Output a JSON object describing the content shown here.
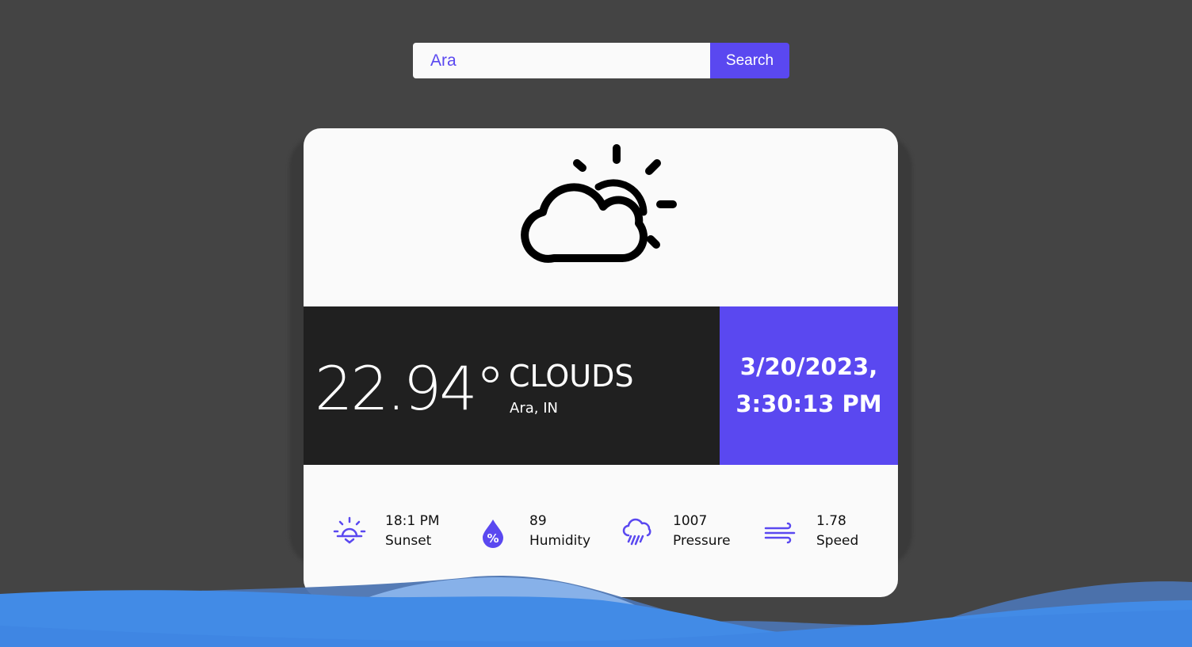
{
  "search": {
    "value": "Ara",
    "button_label": "Search"
  },
  "weather": {
    "icon": "partly-cloudy-day-icon",
    "temperature": "22.94°",
    "condition": "CLOUDS",
    "location": "Ara, IN",
    "date_line1": "3/20/2023,",
    "date_line2": "3:30:13 PM"
  },
  "stats": [
    {
      "icon": "sunset-icon",
      "value": "18:1 PM",
      "label": "Sunset"
    },
    {
      "icon": "humidity-drop-icon",
      "value": "89",
      "label": "Humidity"
    },
    {
      "icon": "rain-cloud-icon",
      "value": "1007",
      "label": "Pressure"
    },
    {
      "icon": "wind-icon",
      "value": "1.78",
      "label": "Speed"
    }
  ],
  "colors": {
    "background": "#444444",
    "accent": "#5a48f0",
    "card": "#fafafa",
    "dark_band": "#202020",
    "wave": "#428be6"
  }
}
